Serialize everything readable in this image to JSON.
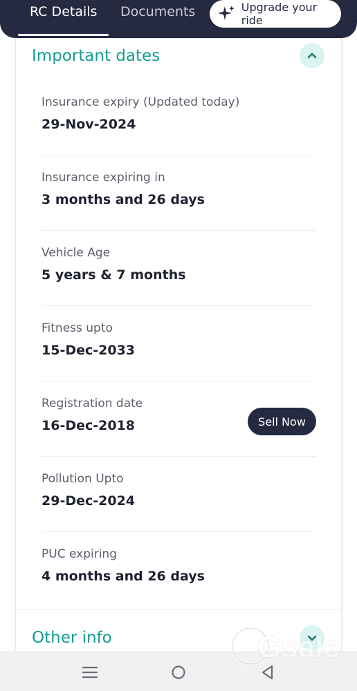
{
  "tabs": [
    {
      "label": "RC Details",
      "active": true
    },
    {
      "label": "Documents",
      "active": false
    }
  ],
  "upgrade": {
    "label": "Upgrade your ride",
    "icon": "sparkle-icon"
  },
  "sections": {
    "important": {
      "title": "Important dates",
      "expanded": true,
      "toggle_icon": "chevron-up-icon"
    },
    "other": {
      "title": "Other info",
      "expanded": false,
      "toggle_icon": "chevron-down-icon"
    }
  },
  "items": [
    {
      "label": "Insurance expiry (Updated today)",
      "value": "29-Nov-2024"
    },
    {
      "label": "Insurance expiring in",
      "value": "3 months and 26 days"
    },
    {
      "label": "Vehicle Age",
      "value": "5 years & 7 months"
    },
    {
      "label": "Fitness upto",
      "value": "15-Dec-2033"
    },
    {
      "label": "Registration date",
      "value": "16-Dec-2018"
    },
    {
      "label": "Pollution Upto",
      "value": "29-Dec-2024"
    },
    {
      "label": "PUC expiring",
      "value": "4 months and 26 days"
    }
  ],
  "sell_button": {
    "label": "Sell Now"
  },
  "watermark": {
    "text": "Gsale"
  },
  "colors": {
    "header_bg": "#252a40",
    "accent_teal": "#159c94",
    "toggle_bg": "#d9f4f1"
  }
}
